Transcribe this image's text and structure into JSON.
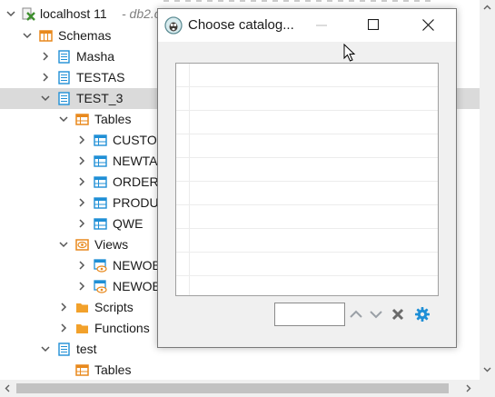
{
  "tree": {
    "rows": [
      {
        "label": "localhost 11",
        "hint": "- db2.c"
      },
      {
        "label": "Schemas"
      },
      {
        "label": "Masha"
      },
      {
        "label": "TESTAS"
      },
      {
        "label": "TEST_3"
      },
      {
        "label": "Tables"
      },
      {
        "label": "CUSTOM"
      },
      {
        "label": "NEWTA"
      },
      {
        "label": "ORDER"
      },
      {
        "label": "PRODU"
      },
      {
        "label": "QWE"
      },
      {
        "label": "Views"
      },
      {
        "label": "NEWOB"
      },
      {
        "label": "NEWOB"
      },
      {
        "label": "Scripts"
      },
      {
        "label": "Functions"
      },
      {
        "label": "test"
      },
      {
        "label": "Tables"
      }
    ]
  },
  "dialog": {
    "title": "Choose catalog...",
    "search_value": "",
    "toolbar": {
      "up_icon": "chevron-up-icon",
      "down_icon": "chevron-down-icon",
      "clear_icon": "close-x-icon",
      "settings_icon": "gear-icon"
    }
  },
  "colors": {
    "selection": "#dadada",
    "folder": "#f2a12b",
    "table_icon": "#1f8fd6",
    "connection_x": "#3e8f2e",
    "settings_gear": "#1f8fd6"
  }
}
